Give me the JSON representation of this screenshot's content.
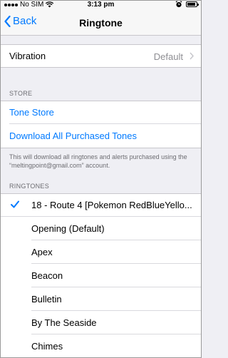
{
  "status_bar": {
    "carrier": "No SIM",
    "time": "3:13 pm",
    "icons": [
      "signal-dots-icon",
      "wifi-icon",
      "alarm-clock-icon",
      "battery-icon"
    ]
  },
  "nav": {
    "back_label": "Back",
    "title": "Ringtone"
  },
  "vibration": {
    "label": "Vibration",
    "value": "Default"
  },
  "store": {
    "header": "STORE",
    "tone_store": "Tone Store",
    "download_all": "Download All Purchased Tones",
    "note": "This will download all ringtones and alerts purchased using the “meltingpoint@gmail.com” account."
  },
  "ringtones": {
    "header": "RINGTONES",
    "selected_index": 0,
    "items": [
      "18 - Route 4 [Pokemon RedBlueYello...",
      "Opening (Default)",
      "Apex",
      "Beacon",
      "Bulletin",
      "By The Seaside",
      "Chimes"
    ]
  },
  "colors": {
    "accent": "#007aff",
    "background": "#efeff4",
    "secondary_text": "#6d6d72"
  }
}
